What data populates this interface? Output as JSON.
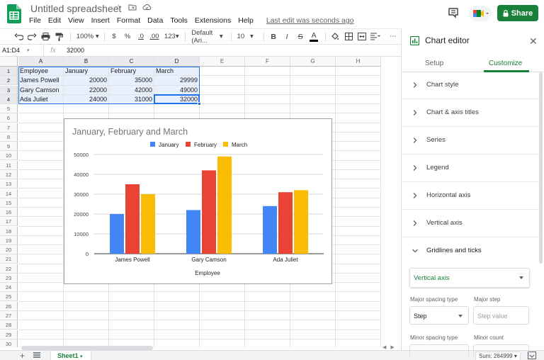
{
  "title_bar": {
    "doc_title": "Untitled spreadsheet",
    "last_edit": "Last edit was seconds ago",
    "share_label": "Share"
  },
  "menu": [
    "File",
    "Edit",
    "View",
    "Insert",
    "Format",
    "Data",
    "Tools",
    "Extensions",
    "Help"
  ],
  "toolbar": {
    "zoom": "100%",
    "currency": "$",
    "percent": "%",
    "dec_decrease": ".0",
    "dec_increase": ".00",
    "more_formats": "123",
    "font": "Default (Ari...",
    "font_size": "10",
    "bold": "B",
    "italic": "I",
    "strike": "S",
    "text_color": "A",
    "more": "⋯"
  },
  "formula_bar": {
    "name_box": "A1:D4",
    "fx": "fx",
    "value": "32000"
  },
  "grid": {
    "columns": [
      "A",
      "B",
      "C",
      "D",
      "E",
      "F",
      "G",
      "H"
    ],
    "rows": [
      "1",
      "2",
      "3",
      "4",
      "5",
      "6",
      "7",
      "8",
      "9",
      "10",
      "11",
      "12",
      "13",
      "14",
      "15",
      "16",
      "17",
      "18",
      "19",
      "20",
      "21",
      "22",
      "23",
      "24",
      "25",
      "26",
      "27",
      "28",
      "29",
      "30"
    ],
    "cells": [
      [
        "Employee",
        "January",
        "February",
        "March"
      ],
      [
        "James Powell",
        "20000",
        "35000",
        "29999"
      ],
      [
        "Gary Camson",
        "22000",
        "42000",
        "49000"
      ],
      [
        "Ada Juliet",
        "24000",
        "31000",
        "32000"
      ]
    ]
  },
  "chart_data": {
    "type": "bar",
    "title": "January, February and March",
    "xlabel": "Employee",
    "ylabel": "",
    "categories": [
      "James Powell",
      "Gary Camson",
      "Ada Juliet"
    ],
    "series": [
      {
        "name": "January",
        "values": [
          20000,
          22000,
          24000
        ],
        "color": "#4285f4"
      },
      {
        "name": "February",
        "values": [
          35000,
          42000,
          31000
        ],
        "color": "#ea4335"
      },
      {
        "name": "March",
        "values": [
          29999,
          49000,
          32000
        ],
        "color": "#fbbc04"
      }
    ],
    "ylim": [
      0,
      50000
    ],
    "yticks": [
      "0",
      "10000",
      "20000",
      "30000",
      "40000",
      "50000"
    ],
    "grid": true,
    "legend": "top"
  },
  "sheets": {
    "active": "Sheet1",
    "sum": "Sum: 284999"
  },
  "chart_editor": {
    "title": "Chart editor",
    "tabs": {
      "setup": "Setup",
      "customize": "Customize"
    },
    "sections": [
      "Chart style",
      "Chart & axis titles",
      "Series",
      "Legend",
      "Horizontal axis",
      "Vertical axis",
      "Gridlines and ticks"
    ],
    "gridlines_axis": "Vertical axis",
    "major_spacing_type": {
      "label": "Major spacing type",
      "value": "Step"
    },
    "major_step": {
      "label": "Major step",
      "placeholder": "Step value"
    },
    "minor_spacing_type": {
      "label": "Minor spacing type"
    },
    "minor_count": {
      "label": "Minor count"
    }
  },
  "colors": {
    "accent": "#188038",
    "selection": "#1a73e8",
    "selection_fill": "#e8f0fe"
  }
}
